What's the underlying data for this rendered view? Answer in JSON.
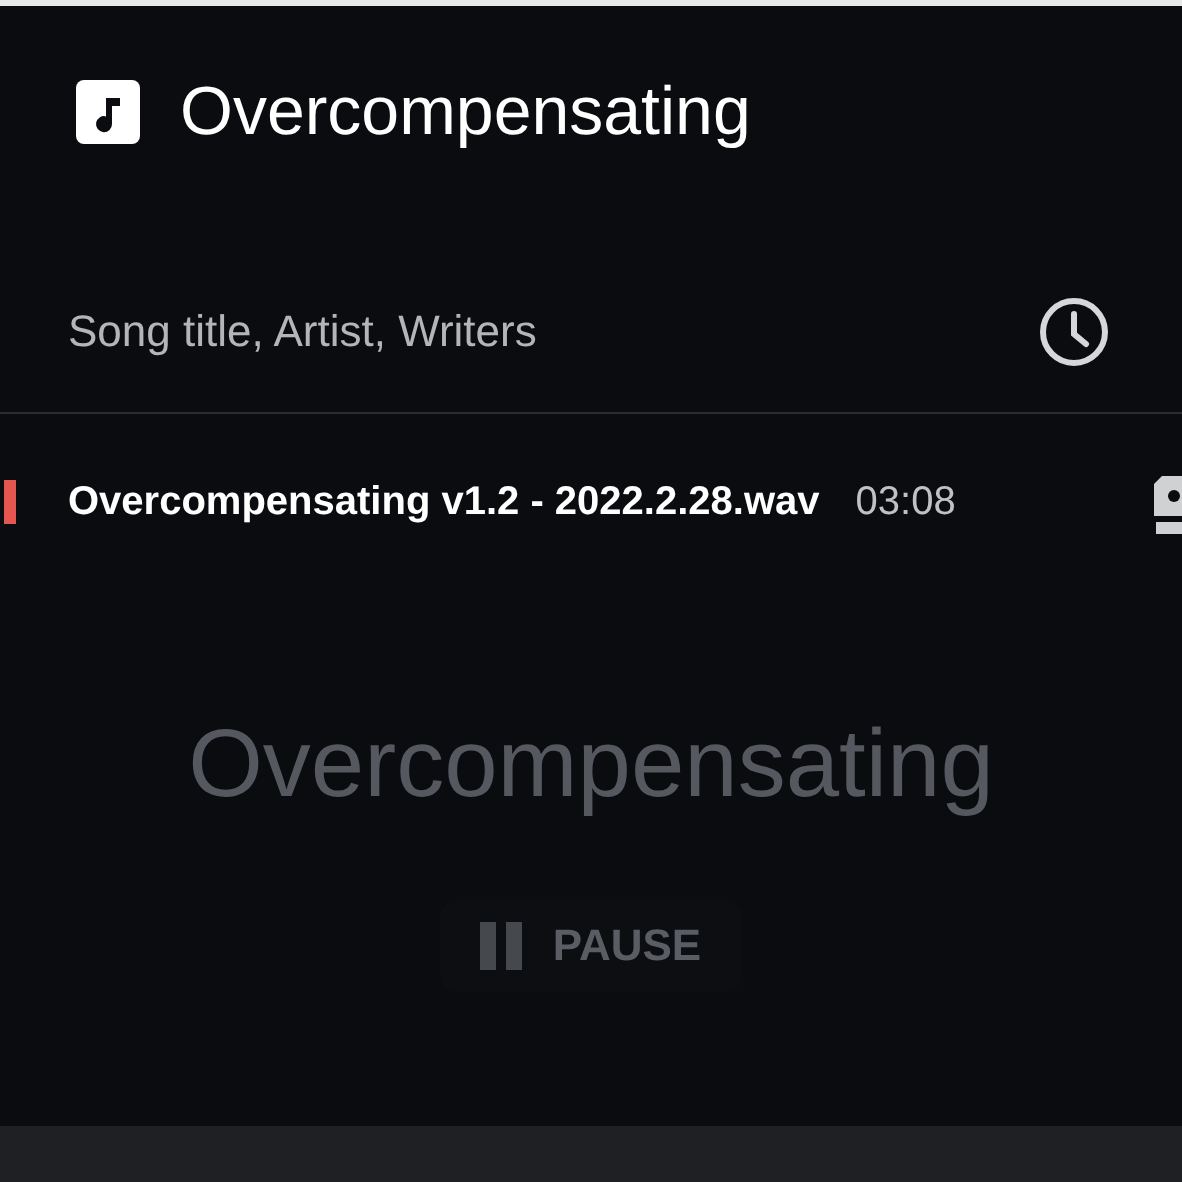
{
  "header": {
    "title": "Overcompensating"
  },
  "search": {
    "placeholder": "Song title, Artist, Writers"
  },
  "tracks": [
    {
      "name": "Overcompensating v1.2 - 2022.2.28.wav",
      "duration": "03:08",
      "playing": true
    }
  ],
  "now_playing": {
    "title": "Overcompensating",
    "button": "PAUSE"
  }
}
